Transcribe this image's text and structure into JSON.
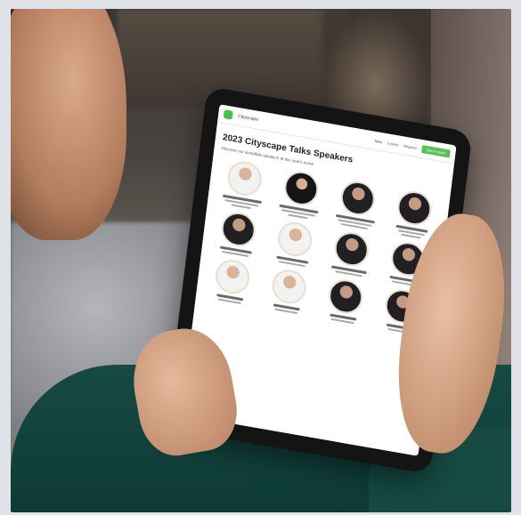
{
  "scene": {
    "subject": "person holding tablet",
    "accent": "#5abf56"
  },
  "tablet_page": {
    "logo_text": "Citiyscape",
    "nav": [
      "Talks",
      "Events",
      "Register"
    ],
    "cta": "Get in touch",
    "title": "2023 Cityscape Talks Speakers",
    "subtitle": "Discover our incredible speakers at this year's event"
  }
}
